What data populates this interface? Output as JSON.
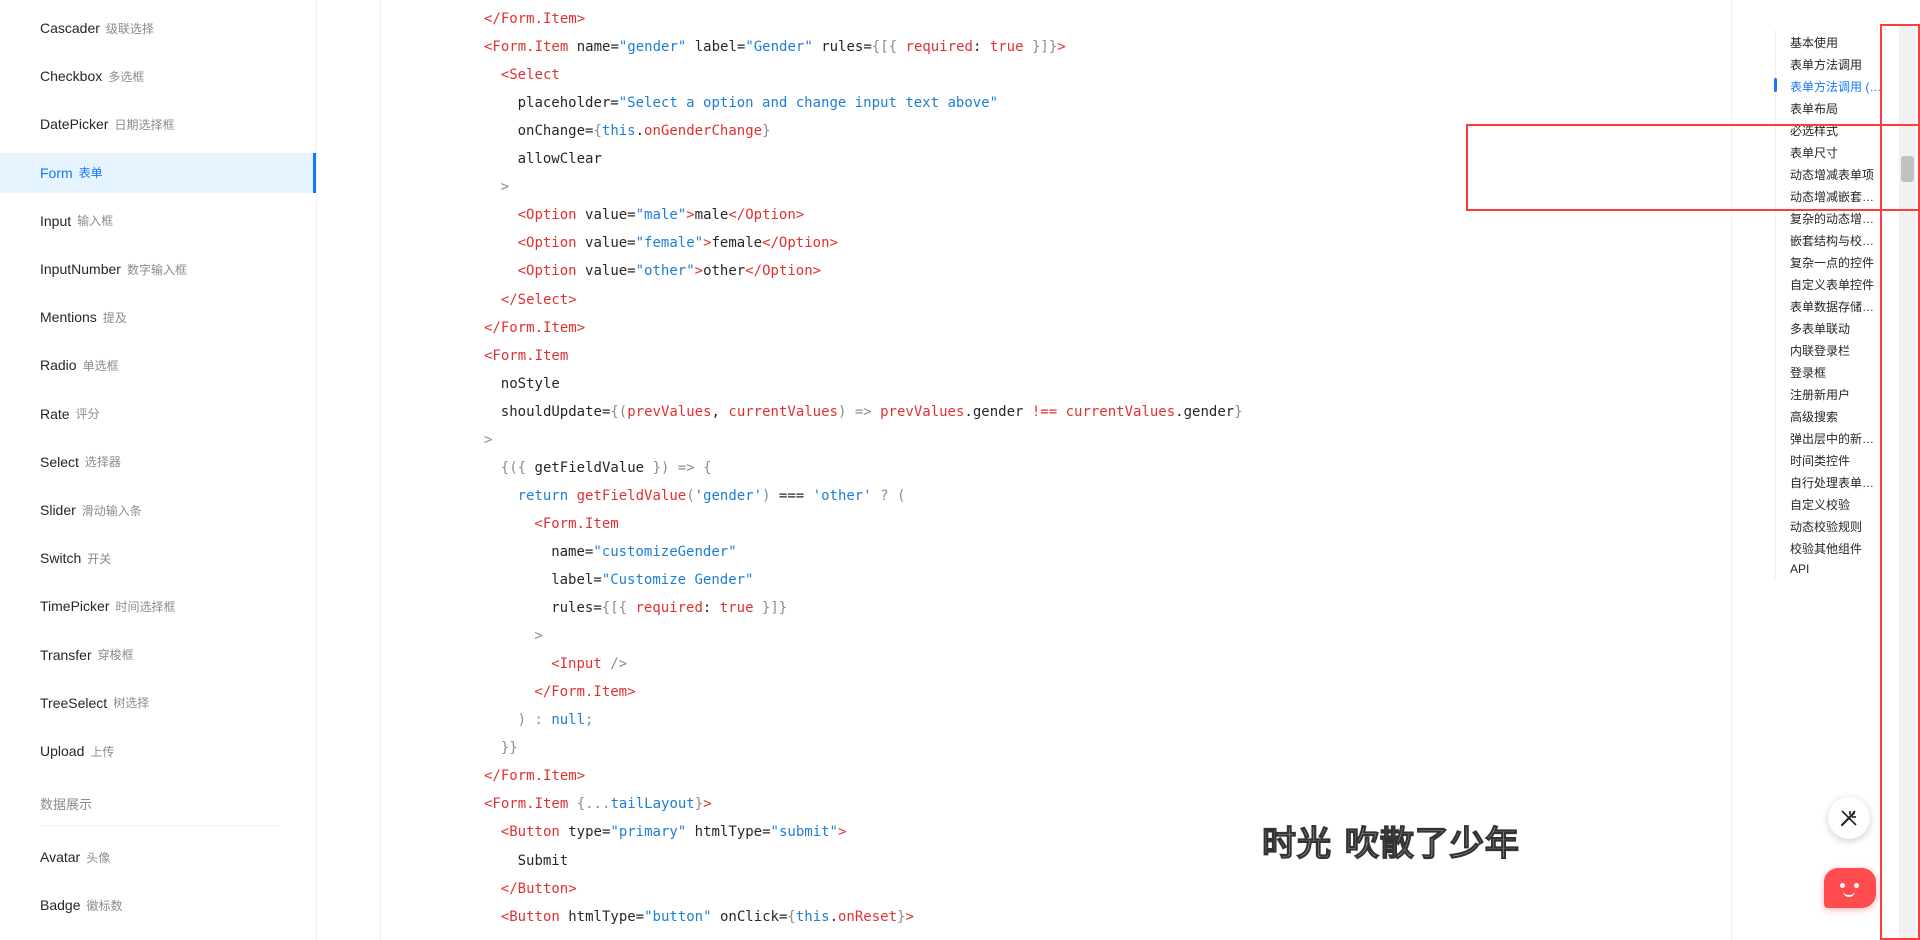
{
  "sidebar": {
    "items": [
      {
        "en": "Cascader",
        "zh": "级联选择",
        "active": false
      },
      {
        "en": "Checkbox",
        "zh": "多选框",
        "active": false
      },
      {
        "en": "DatePicker",
        "zh": "日期选择框",
        "active": false
      },
      {
        "en": "Form",
        "zh": "表单",
        "active": true
      },
      {
        "en": "Input",
        "zh": "输入框",
        "active": false
      },
      {
        "en": "InputNumber",
        "zh": "数字输入框",
        "active": false
      },
      {
        "en": "Mentions",
        "zh": "提及",
        "active": false
      },
      {
        "en": "Radio",
        "zh": "单选框",
        "active": false
      },
      {
        "en": "Rate",
        "zh": "评分",
        "active": false
      },
      {
        "en": "Select",
        "zh": "选择器",
        "active": false
      },
      {
        "en": "Slider",
        "zh": "滑动输入条",
        "active": false
      },
      {
        "en": "Switch",
        "zh": "开关",
        "active": false
      },
      {
        "en": "TimePicker",
        "zh": "时间选择框",
        "active": false
      },
      {
        "en": "Transfer",
        "zh": "穿梭框",
        "active": false
      },
      {
        "en": "TreeSelect",
        "zh": "树选择",
        "active": false
      },
      {
        "en": "Upload",
        "zh": "上传",
        "active": false
      }
    ],
    "group_label": "数据展示",
    "group_items": [
      {
        "en": "Avatar",
        "zh": "头像"
      },
      {
        "en": "Badge",
        "zh": "徽标数"
      }
    ]
  },
  "code": {
    "lines": [
      {
        "indent": 0,
        "tokens": [
          [
            "tag",
            "</Form.Item>"
          ]
        ]
      },
      {
        "indent": 0,
        "tokens": [
          [
            "tag",
            "<Form.Item"
          ],
          [
            "attr",
            " name="
          ],
          [
            "str",
            "\"gender\""
          ],
          [
            "attr",
            " label="
          ],
          [
            "str",
            "\"Gender\""
          ],
          [
            "attr",
            " rules="
          ],
          [
            "punc",
            "{[{"
          ],
          [
            "plain",
            " "
          ],
          [
            "fn",
            "required"
          ],
          [
            "plain",
            ": "
          ],
          [
            "num",
            "true"
          ],
          [
            "punc",
            " }]}"
          ],
          [
            "tag",
            ">"
          ]
        ]
      },
      {
        "indent": 1,
        "tokens": [
          [
            "tag",
            "<Select"
          ]
        ]
      },
      {
        "indent": 2,
        "tokens": [
          [
            "attr",
            "placeholder="
          ],
          [
            "str",
            "\"Select a option and change input text above\""
          ]
        ]
      },
      {
        "indent": 2,
        "tokens": [
          [
            "attr",
            "onChange="
          ],
          [
            "punc",
            "{"
          ],
          [
            "kw",
            "this"
          ],
          [
            "plain",
            "."
          ],
          [
            "fn",
            "onGenderChange"
          ],
          [
            "punc",
            "}"
          ]
        ]
      },
      {
        "indent": 2,
        "tokens": [
          [
            "attr",
            "allowClear"
          ]
        ]
      },
      {
        "indent": 1,
        "tokens": [
          [
            "punc",
            ">"
          ]
        ]
      },
      {
        "indent": 2,
        "tokens": [
          [
            "tag",
            "<Option"
          ],
          [
            "attr",
            " value="
          ],
          [
            "str",
            "\"male\""
          ],
          [
            "tag",
            ">"
          ],
          [
            "plain",
            "male"
          ],
          [
            "tag",
            "</Option>"
          ]
        ]
      },
      {
        "indent": 2,
        "tokens": [
          [
            "tag",
            "<Option"
          ],
          [
            "attr",
            " value="
          ],
          [
            "str",
            "\"female\""
          ],
          [
            "tag",
            ">"
          ],
          [
            "plain",
            "female"
          ],
          [
            "tag",
            "</Option>"
          ]
        ]
      },
      {
        "indent": 2,
        "tokens": [
          [
            "tag",
            "<Option"
          ],
          [
            "attr",
            " value="
          ],
          [
            "str",
            "\"other\""
          ],
          [
            "tag",
            ">"
          ],
          [
            "plain",
            "other"
          ],
          [
            "tag",
            "</Option>"
          ]
        ]
      },
      {
        "indent": 1,
        "tokens": [
          [
            "tag",
            "</Select>"
          ]
        ]
      },
      {
        "indent": 0,
        "tokens": [
          [
            "tag",
            "</Form.Item>"
          ]
        ]
      },
      {
        "indent": 0,
        "tokens": [
          [
            "tag",
            "<Form.Item"
          ]
        ]
      },
      {
        "indent": 1,
        "tokens": [
          [
            "attr",
            "noStyle"
          ]
        ]
      },
      {
        "indent": 1,
        "tokens": [
          [
            "attr",
            "shouldUpdate="
          ],
          [
            "punc",
            "{("
          ],
          [
            "fn",
            "prevValues"
          ],
          [
            "plain",
            ", "
          ],
          [
            "fn",
            "currentValues"
          ],
          [
            "punc",
            ") => "
          ],
          [
            "fn",
            "prevValues"
          ],
          [
            "plain",
            ".gender "
          ],
          [
            "fn",
            "!=="
          ],
          [
            "plain",
            " "
          ],
          [
            "fn",
            "currentValues"
          ],
          [
            "plain",
            ".gender"
          ],
          [
            "punc",
            "}"
          ]
        ]
      },
      {
        "indent": 0,
        "tokens": [
          [
            "punc",
            ">"
          ]
        ]
      },
      {
        "indent": 1,
        "tokens": [
          [
            "punc",
            "{({ "
          ],
          [
            "plain",
            "getFieldValue"
          ],
          [
            "punc",
            " }) => {"
          ]
        ]
      },
      {
        "indent": 2,
        "tokens": [
          [
            "kw",
            "return "
          ],
          [
            "fn",
            "getFieldValue"
          ],
          [
            "punc",
            "("
          ],
          [
            "str",
            "'gender'"
          ],
          [
            "punc",
            ") "
          ],
          [
            "plain",
            "==="
          ],
          [
            "plain",
            " "
          ],
          [
            "str",
            "'other'"
          ],
          [
            "punc",
            " ? ("
          ]
        ]
      },
      {
        "indent": 3,
        "tokens": [
          [
            "tag",
            "<Form.Item"
          ]
        ]
      },
      {
        "indent": 4,
        "tokens": [
          [
            "attr",
            "name="
          ],
          [
            "str",
            "\"customizeGender\""
          ]
        ]
      },
      {
        "indent": 4,
        "tokens": [
          [
            "attr",
            "label="
          ],
          [
            "str",
            "\"Customize Gender\""
          ]
        ]
      },
      {
        "indent": 4,
        "tokens": [
          [
            "attr",
            "rules="
          ],
          [
            "punc",
            "{[{ "
          ],
          [
            "fn",
            "required"
          ],
          [
            "plain",
            ": "
          ],
          [
            "num",
            "true"
          ],
          [
            "punc",
            " }]}"
          ]
        ]
      },
      {
        "indent": 3,
        "tokens": [
          [
            "punc",
            ">"
          ]
        ]
      },
      {
        "indent": 4,
        "tokens": [
          [
            "tag",
            "<Input"
          ],
          [
            "punc",
            " />"
          ]
        ]
      },
      {
        "indent": 3,
        "tokens": [
          [
            "tag",
            "</Form.Item>"
          ]
        ]
      },
      {
        "indent": 2,
        "tokens": [
          [
            "punc",
            ") : "
          ],
          [
            "kw",
            "null"
          ],
          [
            "punc",
            ";"
          ]
        ]
      },
      {
        "indent": 1,
        "tokens": [
          [
            "punc",
            "}}"
          ]
        ]
      },
      {
        "indent": 0,
        "tokens": [
          [
            "tag",
            "</Form.Item>"
          ]
        ]
      },
      {
        "indent": 0,
        "tokens": [
          [
            "tag",
            "<Form.Item"
          ],
          [
            "punc",
            " {..."
          ],
          [
            "kw",
            "tailLayout"
          ],
          [
            "punc",
            "}"
          ],
          [
            "tag",
            ">"
          ]
        ]
      },
      {
        "indent": 1,
        "tokens": [
          [
            "tag",
            "<Button"
          ],
          [
            "attr",
            " type="
          ],
          [
            "str",
            "\"primary\""
          ],
          [
            "attr",
            " htmlType="
          ],
          [
            "str",
            "\"submit\""
          ],
          [
            "tag",
            ">"
          ]
        ]
      },
      {
        "indent": 2,
        "tokens": [
          [
            "plain",
            "Submit"
          ]
        ]
      },
      {
        "indent": 1,
        "tokens": [
          [
            "tag",
            "</Button>"
          ]
        ]
      },
      {
        "indent": 1,
        "tokens": [
          [
            "tag",
            "<Button"
          ],
          [
            "attr",
            " htmlType="
          ],
          [
            "str",
            "\"button\""
          ],
          [
            "attr",
            " onClick="
          ],
          [
            "punc",
            "{"
          ],
          [
            "kw",
            "this"
          ],
          [
            "plain",
            "."
          ],
          [
            "fn",
            "onReset"
          ],
          [
            "punc",
            "}"
          ],
          [
            "tag",
            ">"
          ]
        ]
      }
    ]
  },
  "anchor": {
    "items": [
      {
        "label": "基本使用",
        "active": false
      },
      {
        "label": "表单方法调用",
        "active": false
      },
      {
        "label": "表单方法调用 (Class component)",
        "active": true
      },
      {
        "label": "表单布局",
        "active": false
      },
      {
        "label": "必选样式",
        "active": false
      },
      {
        "label": "表单尺寸",
        "active": false
      },
      {
        "label": "动态增减表单项",
        "active": false
      },
      {
        "label": "动态增减嵌套字段",
        "active": false
      },
      {
        "label": "复杂的动态增减表单项",
        "active": false
      },
      {
        "label": "嵌套结构与校验信息",
        "active": false
      },
      {
        "label": "复杂一点的控件",
        "active": false
      },
      {
        "label": "自定义表单控件",
        "active": false
      },
      {
        "label": "表单数据存储于上层组件",
        "active": false
      },
      {
        "label": "多表单联动",
        "active": false
      },
      {
        "label": "内联登录栏",
        "active": false
      },
      {
        "label": "登录框",
        "active": false
      },
      {
        "label": "注册新用户",
        "active": false
      },
      {
        "label": "高级搜索",
        "active": false
      },
      {
        "label": "弹出层中的新建表单",
        "active": false
      },
      {
        "label": "时间类控件",
        "active": false
      },
      {
        "label": "自行处理表单数据",
        "active": false
      },
      {
        "label": "自定义校验",
        "active": false
      },
      {
        "label": "动态校验规则",
        "active": false
      },
      {
        "label": "校验其他组件",
        "active": false
      },
      {
        "label": "API",
        "active": false
      }
    ]
  },
  "overlay": {
    "subtitle": "时光 吹散了少年"
  },
  "icons": {
    "theme_button": "magic-wand-icon",
    "chat_button": "chat-bot-icon"
  },
  "colors": {
    "accent": "#1677ff",
    "annotation": "#ff3b3b",
    "chat_fab": "#ff4d4f"
  }
}
